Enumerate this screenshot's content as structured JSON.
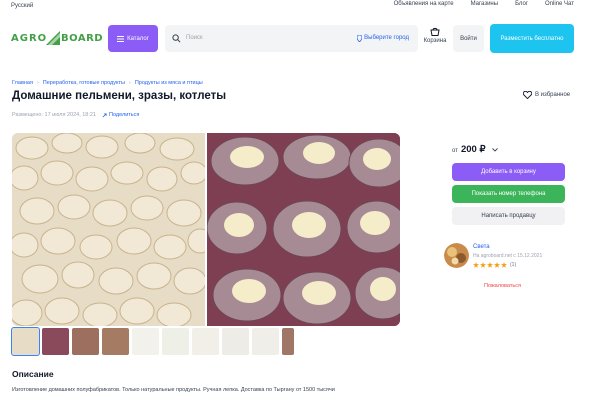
{
  "topbar": {
    "language": "Русский",
    "links": [
      "Объявления на карте",
      "Магазины",
      "Блог",
      "Online Чат"
    ]
  },
  "header": {
    "logo": {
      "left": "AGRO",
      "right": "BOARD"
    },
    "catalog_label": "Каталог",
    "search_placeholder": "Поиск",
    "city_label": "Выберите город",
    "cart_label": "Корзина",
    "login_label": "Войти",
    "post_label": "Разместить бесплатно",
    "colors": {
      "accent": "#8b5cf6",
      "cta": "#1ec4f0",
      "green": "#3cb55a",
      "logo": "#43a047"
    }
  },
  "breadcrumb": [
    "Главная",
    "Переработка, готовые продукты",
    "Продукты из мяса и птицы"
  ],
  "listing": {
    "title": "Домашние пельмени, зразы, котлеты",
    "favorite_label": "В избранное",
    "posted": "Размещено: 17 июля 2024, 18:21",
    "share_label": "Поделиться",
    "price_prefix": "от",
    "price": "200 ₽",
    "add_to_cart": "Добавить в корзину",
    "show_phone": "Показать номер телефона",
    "write_seller": "Написать продавцу",
    "complain": "Пожаловаться"
  },
  "gallery": {
    "photos": [
      "dumplings-photo",
      "zrazy-with-cheese-photo"
    ],
    "thumbnails": [
      "dumplings",
      "cutlets-1",
      "cutlets-2",
      "cutlets-3",
      "doc-1",
      "doc-2",
      "doc-3",
      "doc-4",
      "doc-5",
      "dish"
    ]
  },
  "seller": {
    "name": "Света",
    "since": "На agroboard.net с 15.12.2021",
    "rating": 5,
    "reviews": "(1)"
  },
  "description": {
    "heading": "Описание",
    "text": "Изготовление домашних полуфабрикатов. Только натуральные продукты. Ручная лепка. Доставка по Тыргану от 1500 тысячи"
  }
}
